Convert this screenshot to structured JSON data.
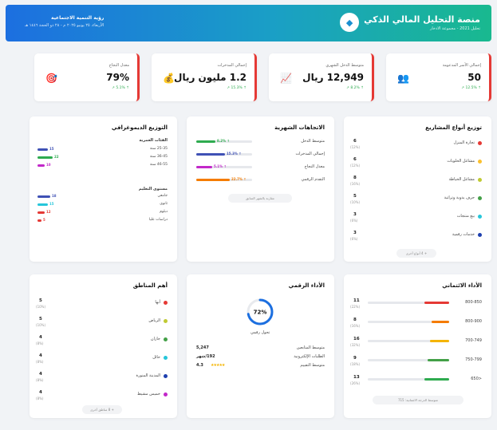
{
  "header": {
    "title": "منصة التحليل المالي الذكي",
    "subtitle": "تحليل 2021 - مجموعة الادخار",
    "left_title": "رؤية التنمية الاجتماعية",
    "left_sub": "الأربعاء، ٢٥ يونيو ٢٠٢٥ م - ٢٨ ذو الحجة ١٤٤٦ هـ"
  },
  "kpis": [
    {
      "label": "إجمالي الأسر المدعومة",
      "value": "50",
      "delta": "↑ 12.5% ↗",
      "icon": "👥"
    },
    {
      "label": "متوسط الدخل الشهري",
      "value": "12,949 ريال",
      "delta": "↑ 8.2% ↗",
      "icon": "📈"
    },
    {
      "label": "إجمالي المدخرات",
      "value": "1.2 مليون ريال",
      "delta": "↑ 15.3% ↗",
      "icon": "💰"
    },
    {
      "label": "معدل النجاح",
      "value": "79%",
      "delta": "↑ 5.1% ↗",
      "icon": "🎯"
    }
  ],
  "projects": {
    "title": "توزيع أنواع المشاريع",
    "items": [
      {
        "label": "تجارة المنزل",
        "count": "6",
        "pct": "(12%)",
        "color": "#e53935"
      },
      {
        "label": "مشاغل الحلويات",
        "count": "6",
        "pct": "(12%)",
        "color": "#fbc02d"
      },
      {
        "label": "مشاغل الخياطة",
        "count": "8",
        "pct": "(16%)",
        "color": "#c0ca33"
      },
      {
        "label": "حرف يدوية وتراثية",
        "count": "5",
        "pct": "(10%)",
        "color": "#43a047"
      },
      {
        "label": "بيع منتجات",
        "count": "3",
        "pct": "(6%)",
        "color": "#26c6da"
      },
      {
        "label": "خدمات رقمية",
        "count": "3",
        "pct": "(6%)",
        "color": "#1e40af"
      }
    ],
    "more": "+ 4 أنواع أخرى"
  },
  "trends": {
    "title": "الاتجاهات الشهرية",
    "items": [
      {
        "label": "متوسط الدخل",
        "value": "↑ 8.2%",
        "fill": 0.34,
        "color": "#2eab4f"
      },
      {
        "label": "إجمالي المدخرات",
        "value": "↑ 15.3%",
        "fill": 0.52,
        "color": "#3f51b5"
      },
      {
        "label": "معدل النجاح",
        "value": "↑ 5.1%",
        "fill": 0.28,
        "color": "#c228c9"
      },
      {
        "label": "التقدم الرقمي",
        "value": "↑ 22.7%",
        "fill": 0.6,
        "color": "#f57c00"
      }
    ],
    "footer": "مقارنة بالشهر السابق"
  },
  "demographic": {
    "title": "التوزيع الديموغرافي",
    "age_title": "الفئات العمرية",
    "ages": [
      {
        "label": "25-35 سنة",
        "count": "15",
        "fill": 0.42,
        "color": "#3f51b5"
      },
      {
        "label": "36-45 سنة",
        "count": "22",
        "fill": 0.62,
        "color": "#2eab4f"
      },
      {
        "label": "46-55 سنة",
        "count": "10",
        "fill": 0.3,
        "color": "#c228c9"
      }
    ],
    "edu_title": "مستوى التعليم",
    "edu": [
      {
        "label": "جامعي",
        "count": "18",
        "fill": 0.52,
        "color": "#3f51b5"
      },
      {
        "label": "ثانوي",
        "count": "15",
        "fill": 0.42,
        "color": "#26c6da"
      },
      {
        "label": "دبلوم",
        "count": "12",
        "fill": 0.3,
        "color": "#e53935"
      },
      {
        "label": "دراسات عليا",
        "count": "5",
        "fill": 0.16,
        "color": "#e53935"
      }
    ]
  },
  "credit": {
    "title": "الأداء الائتماني",
    "items": [
      {
        "label": "800-850",
        "count": "11",
        "pct": "(22%)",
        "fill": 0.3,
        "color": "#e53935"
      },
      {
        "label": "800-900",
        "count": "8",
        "pct": "(16%)",
        "fill": 0.22,
        "color": "#f57c00"
      },
      {
        "label": "700-749",
        "count": "16",
        "pct": "(32%)",
        "fill": 0.24,
        "color": "#f4b400"
      },
      {
        "label": "750-799",
        "count": "9",
        "pct": "(18%)",
        "fill": 0.26,
        "color": "#43a047"
      },
      {
        "label": "<650",
        "count": "13",
        "pct": "(26%)",
        "fill": 0.3,
        "color": "#2eab4f"
      }
    ],
    "footer": "متوسط الدرجة الائتمانية: 715"
  },
  "digital": {
    "title": "الأداء الرقمي",
    "gauge_value": "72%",
    "gauge_fill": 0.72,
    "gauge_label": "تحول رقمي",
    "rows": [
      {
        "label": "متوسط المتابعين",
        "value": "5,247"
      },
      {
        "label": "الطلبات الإلكترونية",
        "value": "192/شهر"
      },
      {
        "label": "متوسط التقييم",
        "value": "4.3",
        "stars": "★★★★★"
      }
    ]
  },
  "regions": {
    "title": "أهم المناطق",
    "items": [
      {
        "label": "أبها",
        "count": "5",
        "pct": "(10%)",
        "color": "#e53935"
      },
      {
        "label": "الرياض",
        "count": "5",
        "pct": "(10%)",
        "color": "#c0ca33"
      },
      {
        "label": "جازان",
        "count": "4",
        "pct": "(8%)",
        "color": "#43a047"
      },
      {
        "label": "حائل",
        "count": "4",
        "pct": "(8%)",
        "color": "#26c6da"
      },
      {
        "label": "المدينة المنورة",
        "count": "4",
        "pct": "(8%)",
        "color": "#1e40af"
      },
      {
        "label": "خميس مشيط",
        "count": "4",
        "pct": "(8%)",
        "color": "#c228c9"
      }
    ],
    "more": "+ 8 مناطق أخرى"
  }
}
